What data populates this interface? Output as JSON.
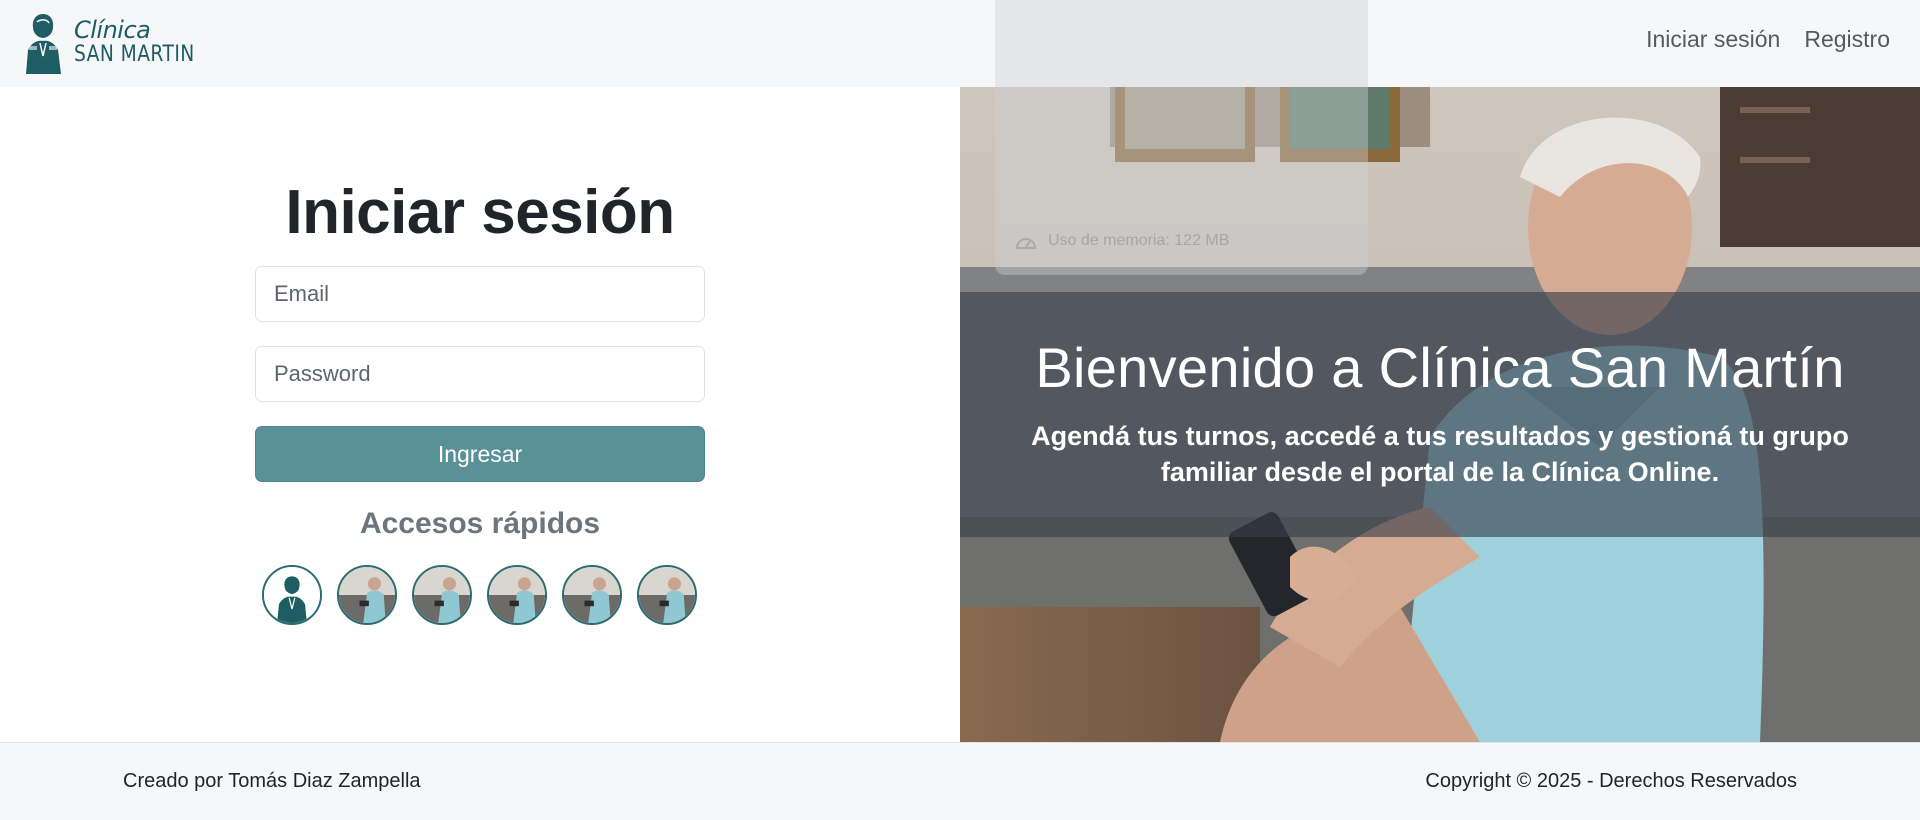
{
  "navbar": {
    "brand": {
      "line1": "Clínica",
      "line2": "SAN MARTIN"
    },
    "links": {
      "login": "Iniciar sesión",
      "register": "Registro"
    }
  },
  "login": {
    "title": "Iniciar sesión",
    "email_placeholder": "Email",
    "password_placeholder": "Password",
    "submit_label": "Ingresar",
    "quick_access_title": "Accesos rápidos",
    "quick_users": [
      {
        "icon": "san-martin-portrait-icon"
      },
      {
        "icon": "user-photo-icon"
      },
      {
        "icon": "user-photo-icon"
      },
      {
        "icon": "user-photo-icon"
      },
      {
        "icon": "user-photo-icon"
      },
      {
        "icon": "user-photo-icon"
      }
    ]
  },
  "hero": {
    "title": "Bienvenido a Clínica San Martín",
    "subtitle": "Agendá tus turnos, accedé a tus resultados y gestioná tu grupo familiar desde el portal de la Clínica Online."
  },
  "overlay_panel": {
    "memory_text": "Uso de memoria: 122 MB"
  },
  "footer": {
    "credit": "Creado por Tomás Diaz Zampella",
    "copyright": "Copyright © 2025 - Derechos Reservados"
  },
  "colors": {
    "brand": "#1f5d64",
    "button": "#5a9198",
    "navbar_bg": "#f6f7f9",
    "hero_overlay": "#373e48"
  }
}
